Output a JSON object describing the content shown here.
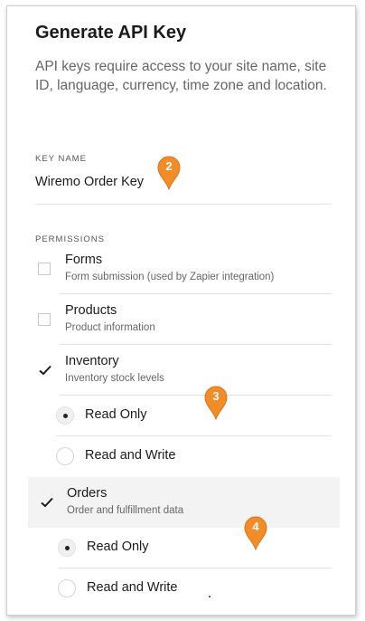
{
  "dialog": {
    "title": "Generate API Key",
    "description": "API keys require access to your site name, site ID, language, currency, time zone and location."
  },
  "key_name": {
    "label": "KEY NAME",
    "value": "Wiremo Order Key"
  },
  "permissions": {
    "label": "PERMISSIONS",
    "items": [
      {
        "title": "Forms",
        "subtitle": "Form submission (used by Zapier integration)",
        "checked": false
      },
      {
        "title": "Products",
        "subtitle": "Product information",
        "checked": false
      },
      {
        "title": "Inventory",
        "subtitle": "Inventory stock levels",
        "checked": true
      },
      {
        "title": "Orders",
        "subtitle": "Order and fulfillment data",
        "checked": true
      }
    ],
    "inventory_access": [
      {
        "label": "Read Only",
        "selected": true
      },
      {
        "label": "Read and Write",
        "selected": false
      }
    ],
    "orders_access": [
      {
        "label": "Read Only",
        "selected": true
      },
      {
        "label": "Read and Write",
        "selected": false
      }
    ]
  },
  "step_markers": [
    "2",
    "3",
    "4"
  ],
  "colors": {
    "marker": "#f28c28",
    "highlight_row": "#f3f3f3"
  }
}
